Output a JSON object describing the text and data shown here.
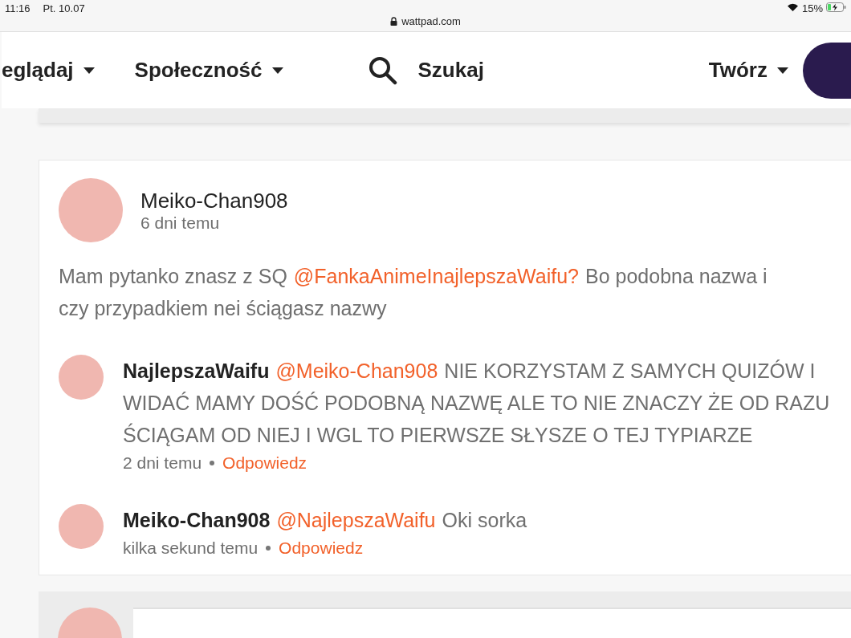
{
  "status_bar": {
    "time": "11:16",
    "date": "Pt. 10.07",
    "url": "wattpad.com",
    "battery": "15%"
  },
  "nav": {
    "items": [
      {
        "label": "eglądaj",
        "kind": "dropdown"
      },
      {
        "label": "Społeczność",
        "kind": "dropdown"
      },
      {
        "label": "Szukaj",
        "kind": "search"
      },
      {
        "label": "Twórz",
        "kind": "dropdown"
      }
    ]
  },
  "comment": {
    "author": "Meiko-Chan908",
    "time": "6 dni temu",
    "lines": [
      [
        {
          "kind": "text",
          "text": "Mam pytanko znasz z SQ"
        },
        {
          "kind": "mention",
          "text": "@FankaAnimeInajlepszaWaifu?"
        },
        {
          "kind": "text",
          "text": "Bo podobna nazwa i"
        }
      ],
      [
        {
          "kind": "text",
          "text": "czy przypadkiem nei ściągasz nazwy"
        }
      ]
    ],
    "replies": [
      {
        "lines": [
          [
            {
              "kind": "author",
              "text": "NajlepszaWaifu"
            },
            {
              "kind": "mention",
              "text": "@Meiko-Chan908"
            },
            {
              "kind": "text",
              "text": "NIE KORZYSTAM Z SAMYCH QUIZÓW I"
            }
          ],
          [
            {
              "kind": "text",
              "text": "WIDAĆ MAMY DOŚĆ PODOBNĄ NAZWĘ ALE TO NIE ZNACZY ŻE OD RAZU"
            }
          ],
          [
            {
              "kind": "text",
              "text": "ŚCIĄGAM OD NIEJ I WGL TO PIERWSZE SŁYSZE O TEJ TYPIARZE"
            }
          ]
        ],
        "time": "2 dni temu",
        "reply_link": "Odpowiedz"
      },
      {
        "lines": [
          [
            {
              "kind": "author",
              "text": "Meiko-Chan908"
            },
            {
              "kind": "mention",
              "text": "@NajlepszaWaifu"
            },
            {
              "kind": "text",
              "text": "Oki sorka"
            }
          ]
        ],
        "time": "kilka sekund temu",
        "reply_link": "Odpowiedz"
      }
    ]
  }
}
